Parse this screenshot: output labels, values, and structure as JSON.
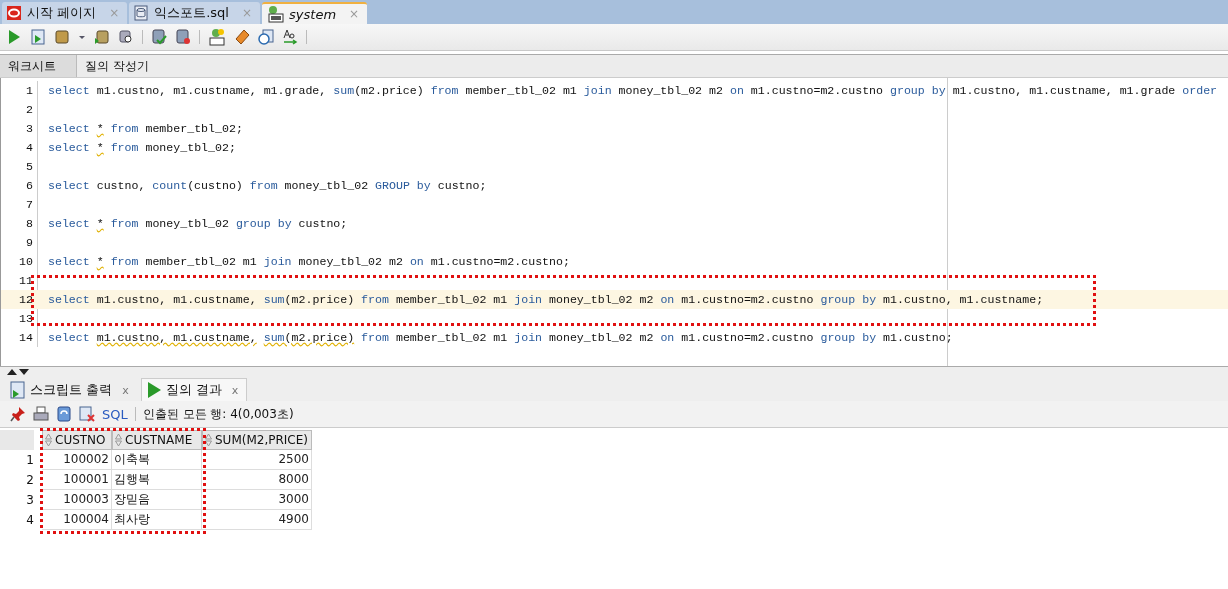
{
  "file_tabs": [
    {
      "label": "시작 페이지",
      "selected": false,
      "close": "×"
    },
    {
      "label": "익스포트.sql",
      "selected": false,
      "close": "×"
    },
    {
      "label": "system",
      "selected": true,
      "close": "×"
    }
  ],
  "sub_tabs": [
    {
      "label": "워크시트",
      "selected": true
    },
    {
      "label": "질의 작성기",
      "selected": false
    }
  ],
  "editor": {
    "lines": [
      {
        "number": "1",
        "current": false,
        "boxed": false,
        "tokens": [
          {
            "text": "select",
            "kind": "kw"
          },
          {
            "text": "m1.custno, m1.custname, m1.grade,",
            "kind": "plain"
          },
          {
            "text": "sum",
            "kind": "kw"
          },
          {
            "text": "(m2.price)",
            "kind": "args"
          },
          {
            "text": "from",
            "kind": "kw"
          },
          {
            "text": "member_tbl_02 m1",
            "kind": "plain"
          },
          {
            "text": "join",
            "kind": "kw"
          },
          {
            "text": "money_tbl_02 m2",
            "kind": "plain"
          },
          {
            "text": "on",
            "kind": "kw"
          },
          {
            "text": "m1.custno=m2.custno",
            "kind": "plain"
          },
          {
            "text": "group",
            "kind": "kw"
          },
          {
            "text": "by",
            "kind": "kw"
          },
          {
            "text": "m1.custno, m1.custname, m1.grade",
            "kind": "plain"
          },
          {
            "text": "order",
            "kind": "kw"
          }
        ]
      },
      {
        "number": "2",
        "current": false,
        "boxed": false
      },
      {
        "number": "3",
        "current": false,
        "boxed": false,
        "tokens": [
          {
            "text": "select",
            "kind": "kw"
          },
          {
            "text": "*",
            "kind": "warn"
          },
          {
            "text": "from",
            "kind": "kw"
          },
          {
            "text": "member_tbl_02;",
            "kind": "plain"
          }
        ]
      },
      {
        "number": "4",
        "current": false,
        "boxed": false,
        "tokens": [
          {
            "text": "select",
            "kind": "kw"
          },
          {
            "text": "*",
            "kind": "warn"
          },
          {
            "text": "from",
            "kind": "kw"
          },
          {
            "text": "money_tbl_02;",
            "kind": "plain"
          }
        ]
      },
      {
        "number": "5",
        "current": false,
        "boxed": false
      },
      {
        "number": "6",
        "current": false,
        "boxed": false,
        "tokens": [
          {
            "text": "select",
            "kind": "kw"
          },
          {
            "text": "custno,",
            "kind": "plain"
          },
          {
            "text": "count",
            "kind": "kw"
          },
          {
            "text": "(custno)",
            "kind": "args"
          },
          {
            "text": "from",
            "kind": "kw"
          },
          {
            "text": "money_tbl_02",
            "kind": "plain"
          },
          {
            "text": "GROUP",
            "kind": "kw"
          },
          {
            "text": "by",
            "kind": "kw"
          },
          {
            "text": "custno;",
            "kind": "plain"
          }
        ]
      },
      {
        "number": "7",
        "current": false,
        "boxed": false
      },
      {
        "number": "8",
        "current": false,
        "boxed": false,
        "tokens": [
          {
            "text": "select",
            "kind": "kw"
          },
          {
            "text": "*",
            "kind": "warn"
          },
          {
            "text": "from",
            "kind": "kw"
          },
          {
            "text": "money_tbl_02",
            "kind": "plain"
          },
          {
            "text": "group",
            "kind": "kw"
          },
          {
            "text": "by",
            "kind": "kw"
          },
          {
            "text": "custno;",
            "kind": "plain"
          }
        ]
      },
      {
        "number": "9",
        "current": false,
        "boxed": false
      },
      {
        "number": "10",
        "current": false,
        "boxed": false,
        "tokens": [
          {
            "text": "select",
            "kind": "kw"
          },
          {
            "text": "*",
            "kind": "warn"
          },
          {
            "text": "from",
            "kind": "kw"
          },
          {
            "text": "member_tbl_02 m1",
            "kind": "plain"
          },
          {
            "text": "join",
            "kind": "kw"
          },
          {
            "text": "money_tbl_02 m2",
            "kind": "plain"
          },
          {
            "text": "on",
            "kind": "kw"
          },
          {
            "text": "m1.custno=m2.custno;",
            "kind": "plain"
          }
        ]
      },
      {
        "number": "11",
        "current": false,
        "boxed": true
      },
      {
        "number": "12",
        "current": true,
        "boxed": true,
        "tokens": [
          {
            "text": "select",
            "kind": "kw"
          },
          {
            "text": "m1.custno, m1.custname,",
            "kind": "plain"
          },
          {
            "text": "sum",
            "kind": "kw"
          },
          {
            "text": "(m2.price)",
            "kind": "args"
          },
          {
            "text": "from",
            "kind": "kw"
          },
          {
            "text": "member_tbl_02 m1",
            "kind": "plain"
          },
          {
            "text": "join",
            "kind": "kw"
          },
          {
            "text": "money_tbl_02 m2",
            "kind": "plain"
          },
          {
            "text": "on",
            "kind": "kw"
          },
          {
            "text": "m1.custno=m2.custno",
            "kind": "plain"
          },
          {
            "text": "group",
            "kind": "kw"
          },
          {
            "text": "by",
            "kind": "kw"
          },
          {
            "text": "m1.custno, m1.custname;",
            "kind": "plain"
          }
        ]
      },
      {
        "number": "13",
        "current": false,
        "boxed": true
      },
      {
        "number": "14",
        "current": false,
        "boxed": false,
        "tokens": [
          {
            "text": "select",
            "kind": "kw"
          },
          {
            "text": "m1.custno, m1.custname,",
            "kind": "warn"
          },
          {
            "text": "sum",
            "kind": "kwwarn"
          },
          {
            "text": "(m2.price)",
            "kind": "argswarn"
          },
          {
            "text": "from",
            "kind": "kw"
          },
          {
            "text": "member_tbl_02 m1",
            "kind": "plain"
          },
          {
            "text": "join",
            "kind": "kw"
          },
          {
            "text": "money_tbl_02 m2",
            "kind": "plain"
          },
          {
            "text": "on",
            "kind": "kw"
          },
          {
            "text": "m1.custno=m2.custno",
            "kind": "plain"
          },
          {
            "text": "group",
            "kind": "kw"
          },
          {
            "text": "by",
            "kind": "kw"
          },
          {
            "text": "m1.custno;",
            "kind": "plain"
          }
        ]
      }
    ]
  },
  "result_tabs": [
    {
      "label": "스크립트 출력",
      "selected": false,
      "close": "x"
    },
    {
      "label": "질의 결과",
      "selected": true,
      "close": "x"
    }
  ],
  "result_toolbar": {
    "sql_link": "SQL",
    "status": "인출된 모든 행: 4(0,003초)"
  },
  "table": {
    "columns": [
      {
        "label": "CUSTNO",
        "boxed": true
      },
      {
        "label": "CUSTNAME",
        "boxed": true
      },
      {
        "label": "SUM(M2,PRICE)",
        "boxed": false
      }
    ],
    "rows": [
      {
        "number": "1",
        "cells": [
          "100002",
          "이축복",
          "2500"
        ]
      },
      {
        "number": "2",
        "cells": [
          "100001",
          "김행복",
          "8000"
        ]
      },
      {
        "number": "3",
        "cells": [
          "100003",
          "장믿음",
          "3000"
        ]
      },
      {
        "number": "4",
        "cells": [
          "100004",
          "최사랑",
          "4900"
        ]
      }
    ]
  }
}
